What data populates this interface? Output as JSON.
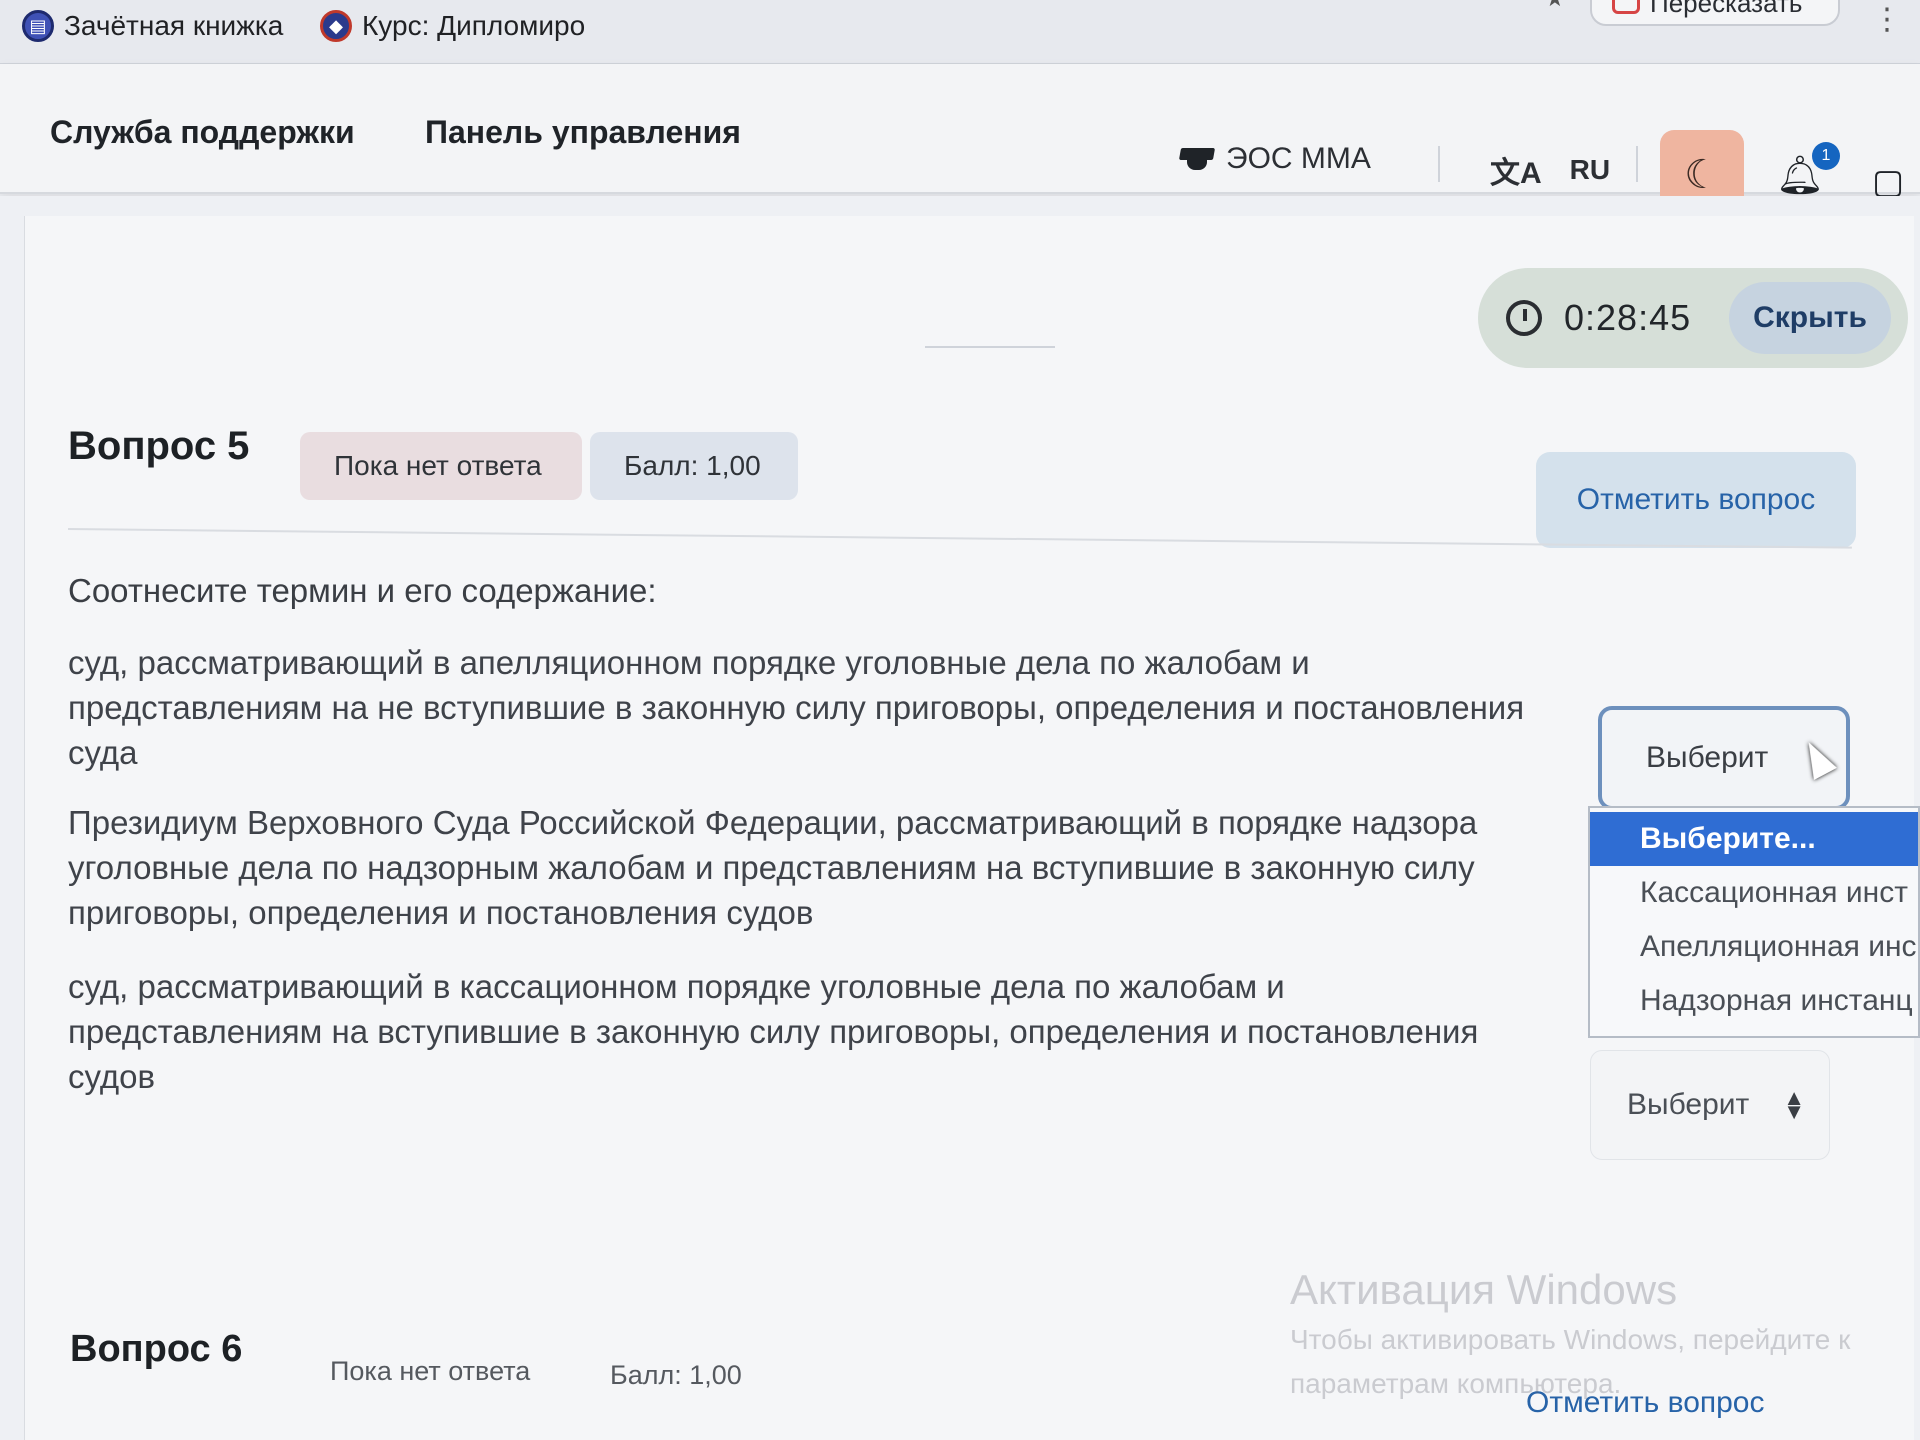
{
  "bookmarks": {
    "items": [
      {
        "label": "Зачётная книжка",
        "icon": "gradebook-icon"
      },
      {
        "label": "Курс: Дипломиро",
        "icon": "course-icon"
      }
    ],
    "summarize_label": "Пересказать"
  },
  "nav": {
    "support": "Служба поддержки",
    "panel": "Панель управления",
    "site": "ЭОС ММА",
    "language": "RU"
  },
  "notifications": {
    "count": "1"
  },
  "timer": {
    "value": "0:28:45",
    "hide_label": "Скрыть"
  },
  "question5": {
    "title": "Вопрос 5",
    "status": "Пока нет ответа",
    "score": "Балл: 1,00",
    "flag_label": "Отметить вопрос",
    "prompt": "Соотнесите термин и его содержание:",
    "terms": [
      "суд, рассматривающий в апелляционном порядке уголовные дела по жалобам и представлениям на не вступившие в законную силу приговоры, определения и постановления суда",
      "Президиум Верховного Суда Российской Федерации, рассматривающий в порядке надзора уголовные дела по надзорным жалобам и представлениям на вступившие в законную силу приговоры, определения и постановления судов",
      "суд, рассматривающий в кассационном порядке уголовные дела по жалобам и представлениям на вступившие в законную силу приговоры, определения и постановления судов"
    ],
    "select_open_value": "Выберит",
    "select_closed_value": "Выберит",
    "options": [
      "Выберите...",
      "Кассационная инст",
      "Апелляционная инс",
      "Надзорная инстанц"
    ]
  },
  "question6": {
    "title": "Вопрос 6",
    "status": "Пока нет ответа",
    "score": "Балл: 1,00",
    "flag_label": "Отметить вопрос"
  },
  "watermark": {
    "title": "Активация Windows",
    "line1": "Чтобы активировать Windows, перейдите к",
    "line2": "параметрам компьютера."
  }
}
